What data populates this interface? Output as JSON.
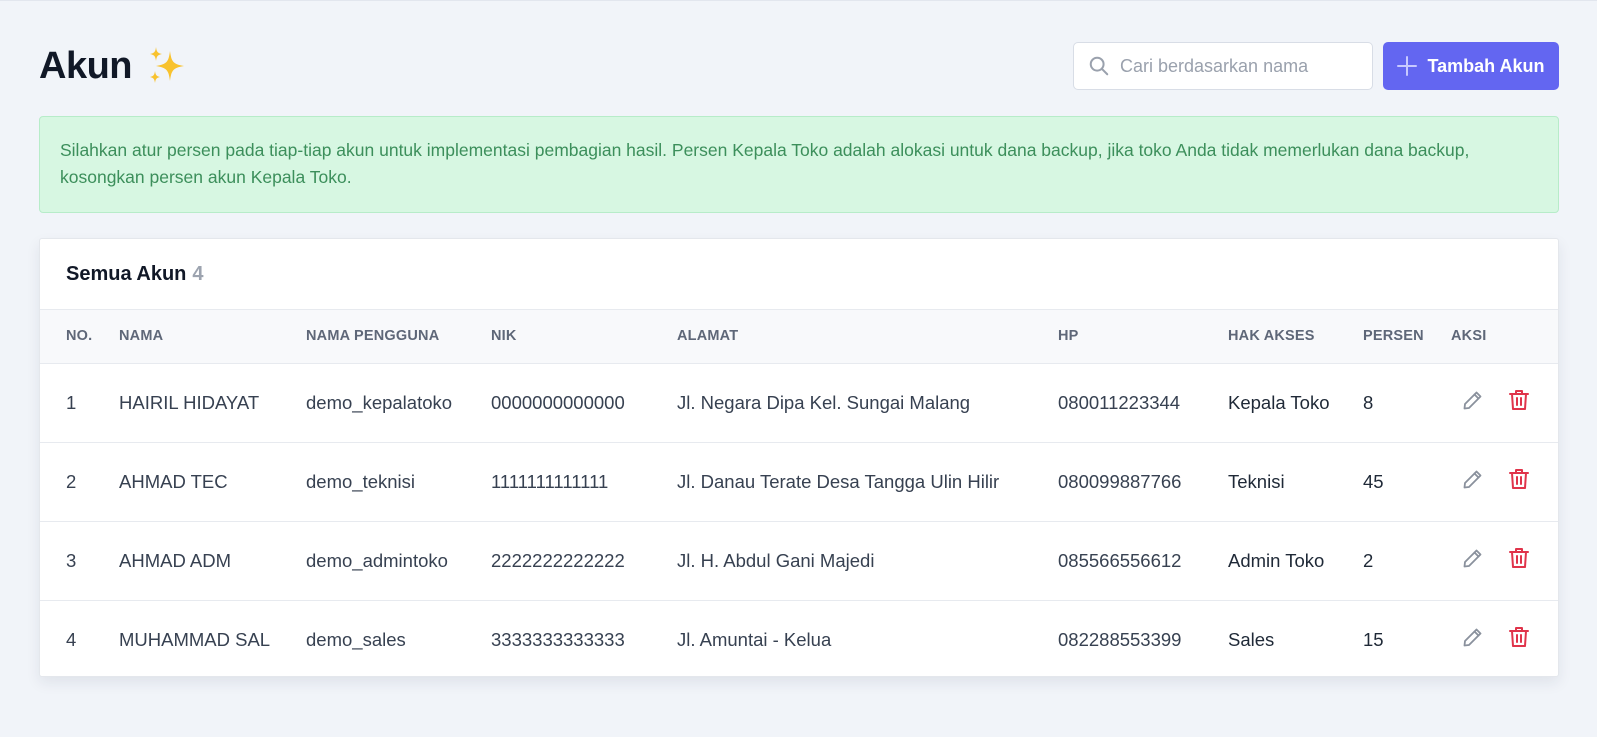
{
  "page": {
    "title": "Akun",
    "title_icon": "sparkles-icon"
  },
  "search": {
    "placeholder": "Cari berdasarkan nama",
    "value": ""
  },
  "add_button": {
    "label": "Tambah Akun"
  },
  "alert": {
    "text": "Silahkan atur persen pada tiap-tiap akun untuk implementasi pembagian hasil. Persen Kepala Toko adalah alokasi untuk dana backup, jika toko Anda tidak memerlukan dana backup, kosongkan persen akun Kepala Toko."
  },
  "table": {
    "title": "Semua Akun",
    "count": "4",
    "headers": [
      "NO.",
      "NAMA",
      "NAMA PENGGUNA",
      "NIK",
      "ALAMAT",
      "HP",
      "HAK AKSES",
      "PERSEN",
      "AKSI"
    ],
    "rows": [
      {
        "no": "1",
        "nama": "HAIRIL HIDAYAT",
        "username": "demo_kepalatoko",
        "nik": "0000000000000",
        "alamat": "Jl. Negara Dipa Kel. Sungai Malang",
        "hp": "080011223344",
        "akses": "Kepala Toko",
        "persen": "8"
      },
      {
        "no": "2",
        "nama": "AHMAD TEC",
        "username": "demo_teknisi",
        "nik": "1111111111111",
        "alamat": "Jl. Danau Terate Desa Tangga Ulin Hilir",
        "hp": "080099887766",
        "akses": "Teknisi",
        "persen": "45"
      },
      {
        "no": "3",
        "nama": "AHMAD ADM",
        "username": "demo_admintoko",
        "nik": "2222222222222",
        "alamat": "Jl. H. Abdul Gani Majedi",
        "hp": "085566556612",
        "akses": "Admin Toko",
        "persen": "2"
      },
      {
        "no": "4",
        "nama": "MUHAMMAD SAL",
        "username": "demo_sales",
        "nik": "3333333333333",
        "alamat": "Jl. Amuntai - Kelua",
        "hp": "082288553399",
        "akses": "Sales",
        "persen": "15"
      }
    ]
  },
  "colors": {
    "accent": "#6366f1",
    "alert_bg": "#d7f7e2",
    "alert_text": "#3c8f5b",
    "delete": "#e0344b",
    "edit": "#8a919d"
  }
}
